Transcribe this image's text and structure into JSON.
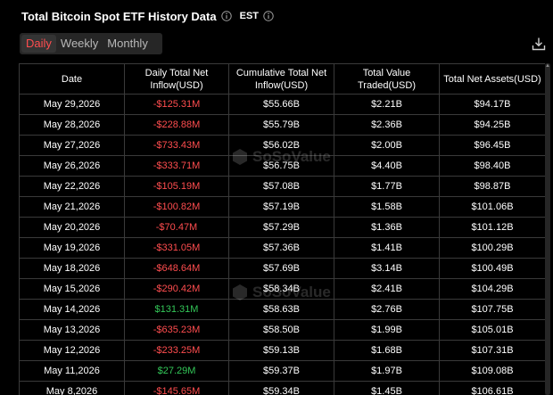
{
  "header": {
    "title": "Total Bitcoin Spot ETF History Data",
    "timezone": "EST"
  },
  "tabs": [
    {
      "label": "Daily",
      "active": true
    },
    {
      "label": "Weekly",
      "active": false
    },
    {
      "label": "Monthly",
      "active": false
    }
  ],
  "watermark": "SoSoValue",
  "table": {
    "columns": [
      "Date",
      "Daily Total Net Inflow(USD)",
      "Cumulative Total Net Inflow(USD)",
      "Total Value Traded(USD)",
      "Total Net Assets(USD)"
    ],
    "rows": [
      {
        "date": "May 29,2026",
        "daily": "-$125.31M",
        "cumulative": "$55.66B",
        "traded": "$2.21B",
        "assets": "$94.17B",
        "sign": "neg"
      },
      {
        "date": "May 28,2026",
        "daily": "-$228.88M",
        "cumulative": "$55.79B",
        "traded": "$2.36B",
        "assets": "$94.25B",
        "sign": "neg"
      },
      {
        "date": "May 27,2026",
        "daily": "-$733.43M",
        "cumulative": "$56.02B",
        "traded": "$2.00B",
        "assets": "$96.45B",
        "sign": "neg"
      },
      {
        "date": "May 26,2026",
        "daily": "-$333.71M",
        "cumulative": "$56.75B",
        "traded": "$4.40B",
        "assets": "$98.40B",
        "sign": "neg"
      },
      {
        "date": "May 22,2026",
        "daily": "-$105.19M",
        "cumulative": "$57.08B",
        "traded": "$1.77B",
        "assets": "$98.87B",
        "sign": "neg"
      },
      {
        "date": "May 21,2026",
        "daily": "-$100.82M",
        "cumulative": "$57.19B",
        "traded": "$1.58B",
        "assets": "$101.06B",
        "sign": "neg"
      },
      {
        "date": "May 20,2026",
        "daily": "-$70.47M",
        "cumulative": "$57.29B",
        "traded": "$1.36B",
        "assets": "$101.12B",
        "sign": "neg"
      },
      {
        "date": "May 19,2026",
        "daily": "-$331.05M",
        "cumulative": "$57.36B",
        "traded": "$1.41B",
        "assets": "$100.29B",
        "sign": "neg"
      },
      {
        "date": "May 18,2026",
        "daily": "-$648.64M",
        "cumulative": "$57.69B",
        "traded": "$3.14B",
        "assets": "$100.49B",
        "sign": "neg"
      },
      {
        "date": "May 15,2026",
        "daily": "-$290.42M",
        "cumulative": "$58.34B",
        "traded": "$2.41B",
        "assets": "$104.29B",
        "sign": "neg"
      },
      {
        "date": "May 14,2026",
        "daily": "$131.31M",
        "cumulative": "$58.63B",
        "traded": "$2.76B",
        "assets": "$107.75B",
        "sign": "pos"
      },
      {
        "date": "May 13,2026",
        "daily": "-$635.23M",
        "cumulative": "$58.50B",
        "traded": "$1.99B",
        "assets": "$105.01B",
        "sign": "neg"
      },
      {
        "date": "May 12,2026",
        "daily": "-$233.25M",
        "cumulative": "$59.13B",
        "traded": "$1.68B",
        "assets": "$107.31B",
        "sign": "neg"
      },
      {
        "date": "May 11,2026",
        "daily": "$27.29M",
        "cumulative": "$59.37B",
        "traded": "$1.97B",
        "assets": "$109.08B",
        "sign": "pos"
      },
      {
        "date": "May 8,2026",
        "daily": "-$145.65M",
        "cumulative": "$59.34B",
        "traded": "$1.45B",
        "assets": "$106.61B",
        "sign": "neg"
      }
    ]
  },
  "colors": {
    "negative": "#ff4d4f",
    "positive": "#33c758",
    "active_tab": "#ff4d4f",
    "border": "#3a3a3a",
    "background": "#000000"
  },
  "icons": {
    "title_info": "info-icon",
    "timezone_info": "info-icon",
    "download": "download-icon"
  }
}
